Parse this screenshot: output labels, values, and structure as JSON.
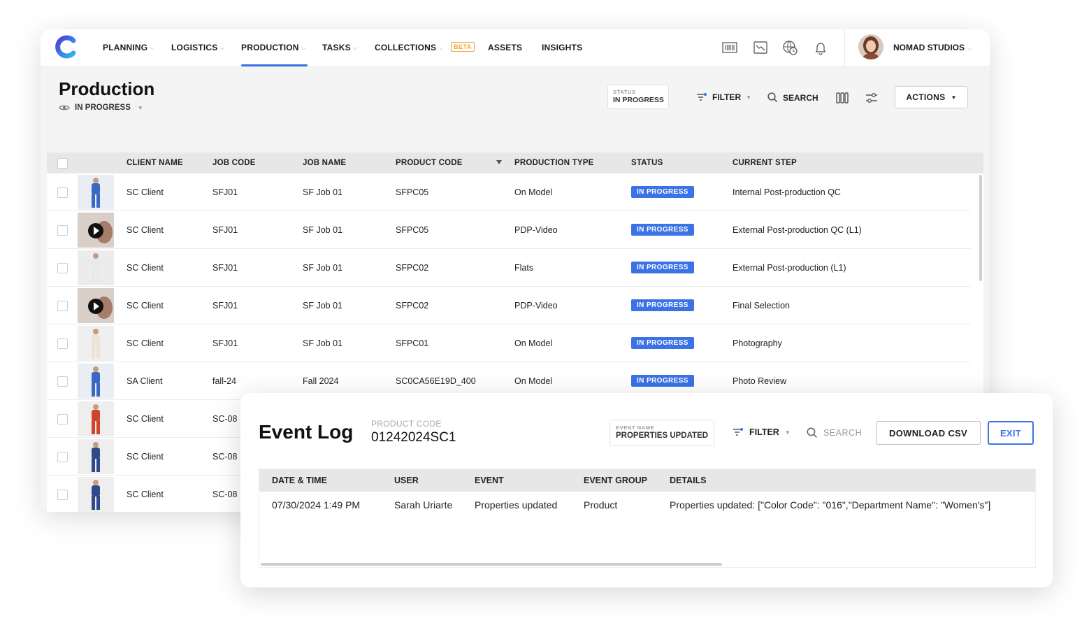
{
  "nav": {
    "items": [
      {
        "label": "PLANNING",
        "has_dropdown": true
      },
      {
        "label": "LOGISTICS",
        "has_dropdown": true
      },
      {
        "label": "PRODUCTION",
        "has_dropdown": true,
        "active": true
      },
      {
        "label": "TASKS",
        "has_dropdown": true
      },
      {
        "label": "COLLECTIONS",
        "has_dropdown": true
      },
      {
        "label": "ASSETS",
        "has_dropdown": false
      },
      {
        "label": "INSIGHTS",
        "has_dropdown": false
      }
    ],
    "beta_label": "BETA",
    "icons": [
      "barcode-icon",
      "chart-icon",
      "globe-clock-icon",
      "bell-icon"
    ],
    "org_name": "NOMAD STUDIOS"
  },
  "page": {
    "title": "Production",
    "view": "IN PROGRESS"
  },
  "toolbar": {
    "status_chip_label": "STATUS",
    "status_chip_value": "IN PROGRESS",
    "filter_label": "FILTER",
    "search_label": "SEARCH",
    "actions_label": "ACTIONS"
  },
  "table": {
    "columns": [
      "CLIENT NAME",
      "JOB CODE",
      "JOB NAME",
      "PRODUCT CODE",
      "PRODUCTION TYPE",
      "STATUS",
      "CURRENT STEP"
    ],
    "rows": [
      {
        "client": "SC Client",
        "job_code": "SFJ01",
        "job_name": "SF Job 01",
        "product_code": "SFPC05",
        "production_type": "On Model",
        "status": "IN PROGRESS",
        "current_step": "Internal Post-production QC",
        "thumb": "model-blue",
        "video": false
      },
      {
        "client": "SC Client",
        "job_code": "SFJ01",
        "job_name": "SF Job 01",
        "product_code": "SFPC05",
        "production_type": "PDP-Video",
        "status": "IN PROGRESS",
        "current_step": "External Post-production QC (L1)",
        "thumb": "video",
        "video": true
      },
      {
        "client": "SC Client",
        "job_code": "SFJ01",
        "job_name": "SF Job 01",
        "product_code": "SFPC02",
        "production_type": "Flats",
        "status": "IN PROGRESS",
        "current_step": "External Post-production (L1)",
        "thumb": "model-white",
        "video": false
      },
      {
        "client": "SC Client",
        "job_code": "SFJ01",
        "job_name": "SF Job 01",
        "product_code": "SFPC02",
        "production_type": "PDP-Video",
        "status": "IN PROGRESS",
        "current_step": "Final Selection",
        "thumb": "video",
        "video": true
      },
      {
        "client": "SC Client",
        "job_code": "SFJ01",
        "job_name": "SF Job 01",
        "product_code": "SFPC01",
        "production_type": "On Model",
        "status": "IN PROGRESS",
        "current_step": "Photography",
        "thumb": "model-cream",
        "video": false
      },
      {
        "client": "SA Client",
        "job_code": "fall-24",
        "job_name": "Fall 2024",
        "product_code": "SC0CA56E19D_400",
        "production_type": "On Model",
        "status": "IN PROGRESS",
        "current_step": "Photo Review",
        "thumb": "model-blue",
        "video": false
      },
      {
        "client": "SC Client",
        "job_code": "SC-08",
        "thumb": "model-red",
        "video": false
      },
      {
        "client": "SC Client",
        "job_code": "SC-08",
        "thumb": "model-navy",
        "video": false
      },
      {
        "client": "SC Client",
        "job_code": "SC-08",
        "thumb": "model-navy",
        "video": false
      }
    ]
  },
  "event_log": {
    "title": "Event Log",
    "product_code_label": "PRODUCT CODE",
    "product_code": "01242024SC1",
    "event_chip_label": "EVENT NAME",
    "event_chip_value": "PROPERTIES UPDATED",
    "filter_label": "FILTER",
    "search_placeholder": "SEARCH",
    "download_label": "DOWNLOAD CSV",
    "exit_label": "EXIT",
    "columns": [
      "DATE & TIME",
      "USER",
      "EVENT",
      "EVENT GROUP",
      "DETAILS"
    ],
    "rows": [
      {
        "datetime": "07/30/2024 1:49 PM",
        "user": "Sarah Uriarte",
        "event": "Properties updated",
        "group": "Product",
        "details": "Properties updated: [\"Color Code\": \"016\",\"Department Name\": \"Women's\"]"
      }
    ]
  },
  "colors": {
    "accent": "#3b73e6",
    "beta": "#f5a43a",
    "header_bg": "#e7e7e8"
  }
}
